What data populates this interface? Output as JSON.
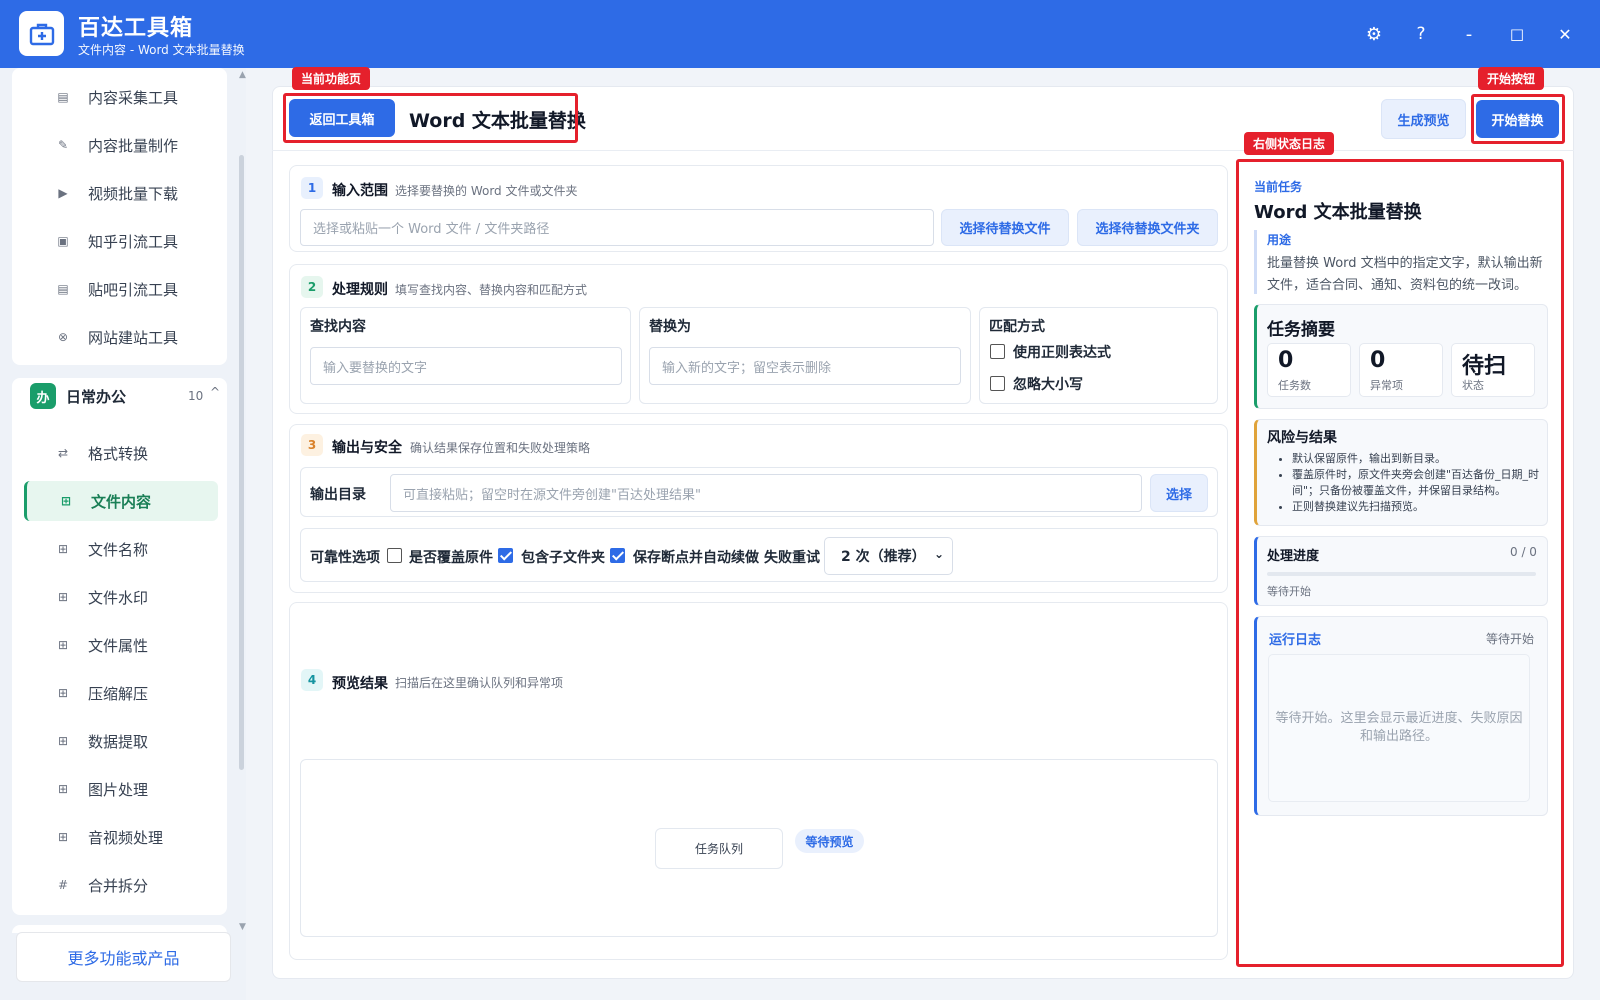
{
  "app": {
    "title": "百达工具箱",
    "subtitle": "文件内容 - Word 文本批量替换"
  },
  "window_controls": {
    "settings": "⚙",
    "help": "?",
    "minimize": "-",
    "maximize": "□",
    "close": "✕"
  },
  "sidebar": {
    "top_items": [
      {
        "label": "内容采集工具",
        "icon": "document-icon"
      },
      {
        "label": "内容批量制作",
        "icon": "pen-icon"
      },
      {
        "label": "视频批量下载",
        "icon": "video-icon"
      },
      {
        "label": "知乎引流工具",
        "icon": "zhihu-icon"
      },
      {
        "label": "贴吧引流工具",
        "icon": "tieba-icon"
      },
      {
        "label": "网站建站工具",
        "icon": "globe-icon"
      }
    ],
    "group": {
      "badge": "办",
      "title": "日常办公",
      "count": "10",
      "toggle": "^"
    },
    "group_items": [
      {
        "label": "格式转换",
        "icon": "convert-icon"
      },
      {
        "label": "文件内容",
        "icon": "grid-icon",
        "active": true
      },
      {
        "label": "文件名称",
        "icon": "grid-icon"
      },
      {
        "label": "文件水印",
        "icon": "grid-icon"
      },
      {
        "label": "文件属性",
        "icon": "grid-icon"
      },
      {
        "label": "压缩解压",
        "icon": "grid-icon"
      },
      {
        "label": "数据提取",
        "icon": "grid-icon"
      },
      {
        "label": "图片处理",
        "icon": "grid-icon"
      },
      {
        "label": "音视频处理",
        "icon": "grid-icon"
      },
      {
        "label": "合并拆分",
        "icon": "hash-icon"
      }
    ],
    "more_button": "更多功能或产品"
  },
  "header": {
    "back_button": "返回工具箱",
    "page_title": "Word 文本批量替换",
    "preview_button": "生成预览",
    "start_button": "开始替换"
  },
  "annotations": {
    "current_page": "当前功能页",
    "start_button": "开始按钮",
    "status_log": "右侧状态日志"
  },
  "sections": {
    "input": {
      "num": "1",
      "title": "输入范围",
      "desc": "选择要替换的 Word 文件或文件夹",
      "path_placeholder": "选择或粘贴一个 Word 文件 / 文件夹路径",
      "select_file": "选择待替换文件",
      "select_folder": "选择待替换文件夹"
    },
    "rules": {
      "num": "2",
      "title": "处理规则",
      "desc": "填写查找内容、替换内容和匹配方式",
      "find_label": "查找内容",
      "find_placeholder": "输入要替换的文字",
      "replace_label": "替换为",
      "replace_placeholder": "输入新的文字；留空表示删除",
      "match_label": "匹配方式",
      "regex_label": "使用正则表达式",
      "regex_checked": false,
      "ignore_case_label": "忽略大小写",
      "ignore_case_checked": false
    },
    "output": {
      "num": "3",
      "title": "输出与安全",
      "desc": "确认结果保存位置和失败处理策略",
      "dir_label": "输出目录",
      "dir_placeholder": "可直接粘贴；留空时在源文件旁创建\"百达处理结果\"",
      "dir_button": "选择",
      "reliability_label": "可靠性选项",
      "overwrite_label": "是否覆盖原件",
      "overwrite_checked": false,
      "subfolder_label": "包含子文件夹",
      "subfolder_checked": true,
      "resume_label": "保存断点并自动续做",
      "resume_checked": true,
      "retry_label": "失败重试",
      "retry_value": "2 次（推荐）"
    },
    "preview": {
      "num": "4",
      "title": "预览结果",
      "desc": "扫描后在这里确认队列和异常项",
      "queue_label": "任务队列",
      "status_badge": "等待预览"
    }
  },
  "right_panel": {
    "current_task_label": "当前任务",
    "task_title": "Word 文本批量替换",
    "usage_label": "用途",
    "usage_text": "批量替换 Word 文档中的指定文字，默认输出新文件，适合合同、通知、资料包的统一改词。",
    "summary": {
      "title": "任务摘要",
      "items": [
        {
          "value": "0",
          "caption": "任务数"
        },
        {
          "value": "0",
          "caption": "异常项"
        },
        {
          "value": "待扫",
          "caption": "状态"
        }
      ]
    },
    "risk": {
      "title": "风险与结果",
      "items": [
        "默认保留原件，输出到新目录。",
        "覆盖原件时，原文件夹旁会创建\"百达备份_日期_时间\"；只备份被覆盖文件，并保留目录结构。",
        "正则替换建议先扫描预览。"
      ]
    },
    "progress": {
      "title": "处理进度",
      "count": "0 / 0",
      "fraction": 0,
      "status": "等待开始"
    },
    "log": {
      "title": "运行日志",
      "status": "等待开始",
      "placeholder": "等待开始。这里会显示最近进度、失败原因和输出路径。"
    }
  },
  "colors": {
    "brand": "#2e6be6",
    "annotation": "#e5202c",
    "active_green": "#1a9d6a"
  }
}
